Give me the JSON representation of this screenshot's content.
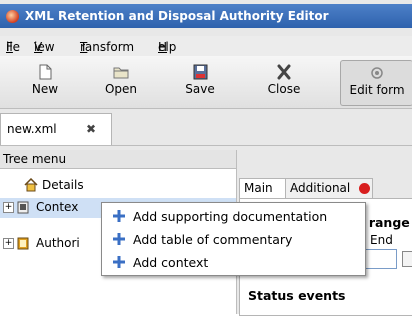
{
  "window": {
    "title": "XML Retention and Disposal Authority Editor"
  },
  "menubar": [
    {
      "label": "File",
      "mnemonic": "F",
      "rest": "ile"
    },
    {
      "label": "View",
      "mnemonic": "V",
      "rest": "iew"
    },
    {
      "label": "Transform",
      "mnemonic": "T",
      "rest": "ransform"
    },
    {
      "label": "Help",
      "mnemonic": "H",
      "rest": "elp"
    }
  ],
  "toolbar": {
    "new_label": "New",
    "open_label": "Open",
    "save_label": "Save",
    "close_label": "Close",
    "edit_form_label": "Edit form"
  },
  "doc_tab": {
    "label": "new.xml"
  },
  "tree": {
    "header": "Tree menu",
    "details": "Details",
    "context": "Contex",
    "authority": "Authori"
  },
  "right_panel": {
    "tab_main": "Main",
    "tab_additional": "Additional",
    "range_label": "e range",
    "end_label": "End",
    "status_events": "Status events"
  },
  "context_menu": {
    "items": [
      {
        "label": "Add supporting documentation"
      },
      {
        "label": "Add table of commentary"
      },
      {
        "label": "Add context"
      }
    ]
  },
  "colors": {
    "titlebar": "#2e62ad",
    "accent_plus": "#3a6fc4",
    "status_red": "#d81e1e"
  }
}
